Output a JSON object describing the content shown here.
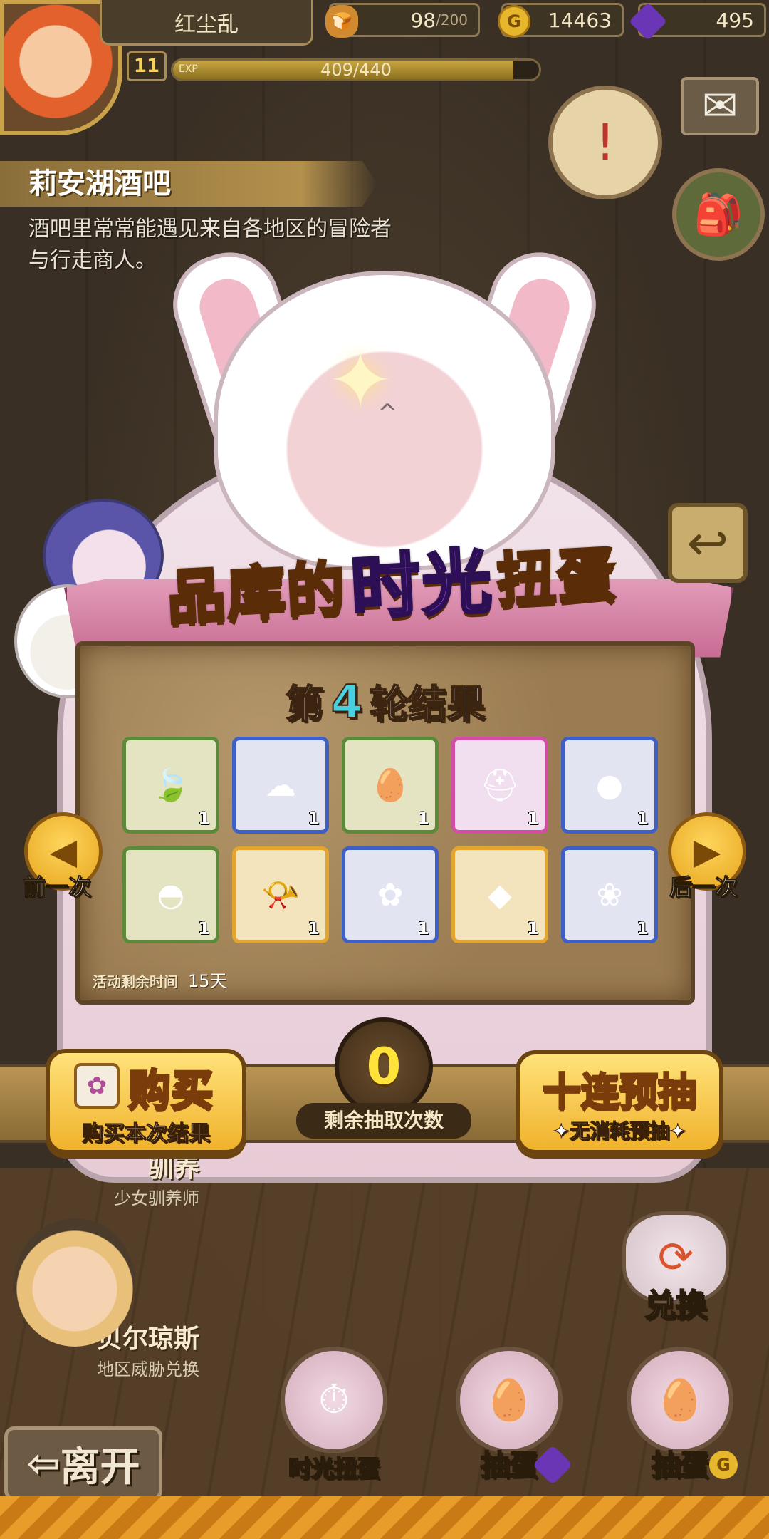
{
  "player": {
    "name": "红尘乱",
    "level": "11",
    "exp_label": "EXP",
    "exp_text": "409/440",
    "exp_fraction": 0.93
  },
  "resources": {
    "stamina": {
      "value": "98",
      "max": "/200",
      "icon": "bread-icon"
    },
    "gold": {
      "value": "14463",
      "icon_glyph": "G"
    },
    "gems": {
      "value": "495",
      "icon": "gem-icon"
    }
  },
  "location": {
    "title": "莉安湖酒吧",
    "description": "酒吧里常常能遇见来自各地区的冒险者与行走商人。"
  },
  "event": {
    "title_left": "品库的",
    "title_highlight": "时光",
    "title_right": "扭蛋",
    "round_prefix": "第",
    "round_number": "4",
    "round_suffix": "轮结果",
    "remaining_time_label": "活动剩余时间",
    "remaining_time_value": "15天",
    "prev_label": "前一次",
    "next_label": "后一次"
  },
  "results": [
    {
      "rarity": "green",
      "icon": "leaf-icon",
      "glyph": "🍃",
      "qty": "1"
    },
    {
      "rarity": "blue",
      "icon": "fluffy-pet-icon",
      "glyph": "☁",
      "qty": "1"
    },
    {
      "rarity": "green",
      "icon": "egg-hat-icon",
      "glyph": "🥚",
      "qty": "1"
    },
    {
      "rarity": "pink",
      "icon": "dark-helmet-icon",
      "glyph": "⛑",
      "qty": "1"
    },
    {
      "rarity": "blue",
      "icon": "slime-icon",
      "glyph": "●",
      "qty": "1"
    },
    {
      "rarity": "green",
      "icon": "glowing-armor-icon",
      "glyph": "◓",
      "qty": "1"
    },
    {
      "rarity": "gold",
      "icon": "horn-icon",
      "glyph": "📯",
      "qty": "1"
    },
    {
      "rarity": "blue",
      "icon": "crystal-bud-icon",
      "glyph": "✿",
      "qty": "1"
    },
    {
      "rarity": "gold",
      "icon": "dark-orb-icon",
      "glyph": "◆",
      "qty": "1"
    },
    {
      "rarity": "blue",
      "icon": "lotus-icon",
      "glyph": "❀",
      "qty": "1"
    }
  ],
  "actions": {
    "buy_big": "购买",
    "buy_small": "购买本次结果",
    "draws_remaining_value": "0",
    "draws_remaining_label": "剩余抽取次数",
    "ten_big": "十连预抽",
    "ten_small_hl": "无消耗",
    "ten_small_rest": "预抽"
  },
  "npcs": {
    "girl_sub": "少女驯养师",
    "girl_name_partial": "驯养",
    "bells_name": "贝尔琼斯",
    "bells_sub": "地区威胁兑换"
  },
  "bottom_nav": {
    "leave": "离开",
    "exchange": "兑换",
    "time_gacha": "时光扭蛋",
    "draw_gem": "抽蛋",
    "draw_coin": "抽蛋",
    "coin_glyph": "G"
  }
}
